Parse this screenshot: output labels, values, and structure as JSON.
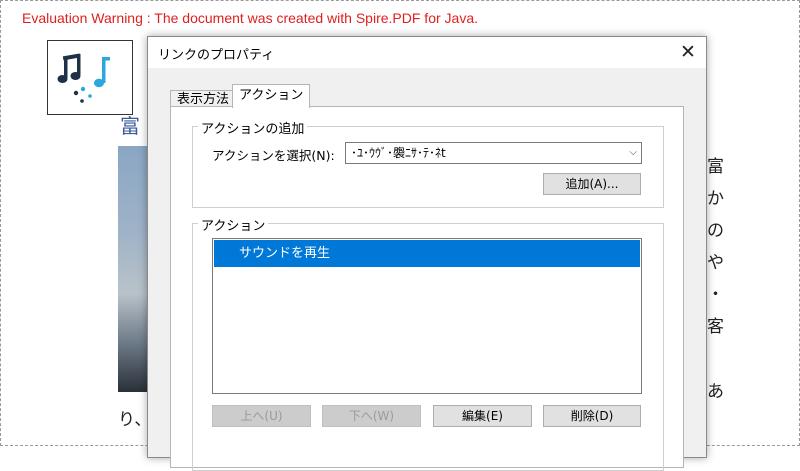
{
  "background_document": {
    "evaluation_warning": "Evaluation Warning : The document was created with Spire.PDF for Java.",
    "heading_fragment": "富",
    "right_column_chars": [
      "富",
      "か",
      "の",
      "や",
      "・",
      "客",
      "あ"
    ],
    "footer_fragment": "り、",
    "logo_icon": "music-notes-icon"
  },
  "dialog": {
    "title": "リンクのプロパティ",
    "close_label": "✕",
    "tabs": [
      {
        "label": "表示方法",
        "selected": false
      },
      {
        "label": "アクション",
        "selected": true
      }
    ],
    "add_group": {
      "label": "アクションの追加",
      "select_label": "アクションを選択(N):",
      "select_value": "･ﾕ･ｳｳﾞ･褜ﾆｻ･ﾃ･ﾈt",
      "add_button": "追加(A)..."
    },
    "actions_group": {
      "label": "アクション",
      "items": [
        "サウンドを再生"
      ],
      "buttons": {
        "up": "上へ(U)",
        "down": "下へ(W)",
        "edit": "編集(E)",
        "delete": "削除(D)"
      }
    }
  },
  "colors": {
    "warning_text": "#e02020",
    "selection": "#0078d7",
    "heading": "#3a5a9a"
  }
}
